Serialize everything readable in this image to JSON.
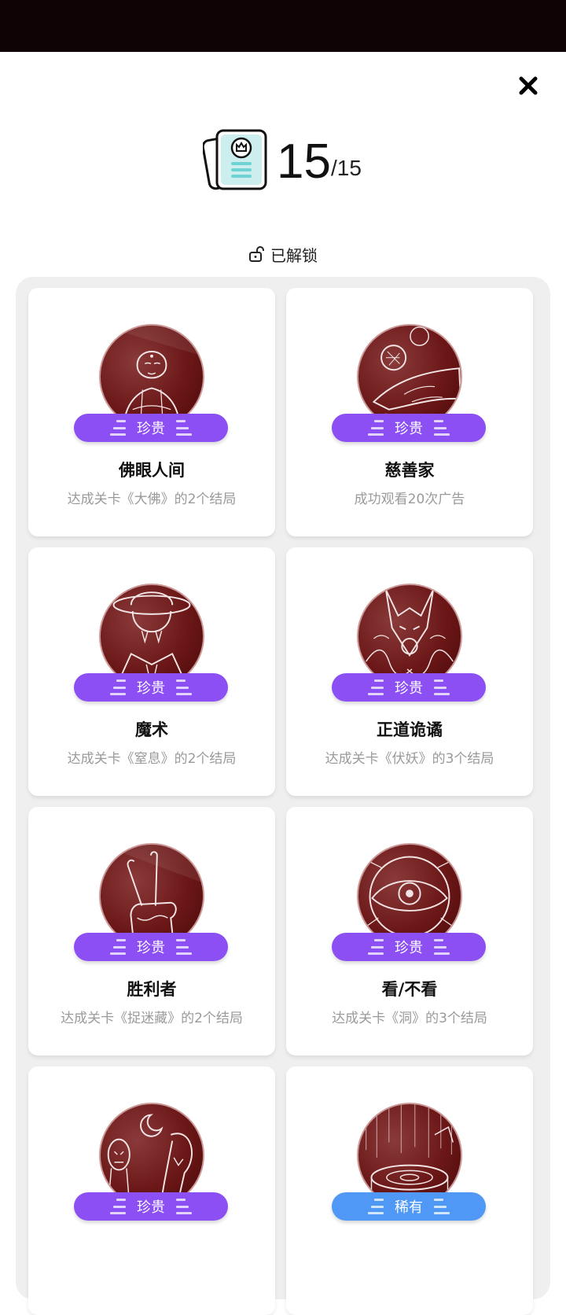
{
  "header": {
    "close_icon": "close-icon",
    "collected_count": "15",
    "total_count": "/15",
    "unlock_label": "已解锁"
  },
  "colors": {
    "rare_badge": "#8c4ff3",
    "uncommon_badge": "#4f98f5",
    "portrait_red": "#6b1717",
    "panel_bg": "#efefef"
  },
  "cards": [
    {
      "title": "佛眼人间",
      "desc": "达成关卡《大佛》的2个结局",
      "rarity": "珍贵",
      "icon": "buddha-icon"
    },
    {
      "title": "慈善家",
      "desc": "成功观看20次广告",
      "rarity": "珍贵",
      "icon": "coin-hand-icon"
    },
    {
      "title": "魔术",
      "desc": "达成关卡《窒息》的2个结局",
      "rarity": "珍贵",
      "icon": "magician-icon"
    },
    {
      "title": "正道诡谲",
      "desc": "达成关卡《伏妖》的3个结局",
      "rarity": "珍贵",
      "icon": "fox-demon-icon"
    },
    {
      "title": "胜利者",
      "desc": "达成关卡《捉迷藏》的2个结局",
      "rarity": "珍贵",
      "icon": "victory-hand-icon"
    },
    {
      "title": "看/不看",
      "desc": "达成关卡《洞》的3个结局",
      "rarity": "珍贵",
      "icon": "eye-icon"
    },
    {
      "title": "",
      "desc": "",
      "rarity": "珍贵",
      "icon": "ghosts-moon-icon"
    },
    {
      "title": "",
      "desc": "",
      "rarity": "稀有",
      "icon": "well-icon"
    }
  ]
}
